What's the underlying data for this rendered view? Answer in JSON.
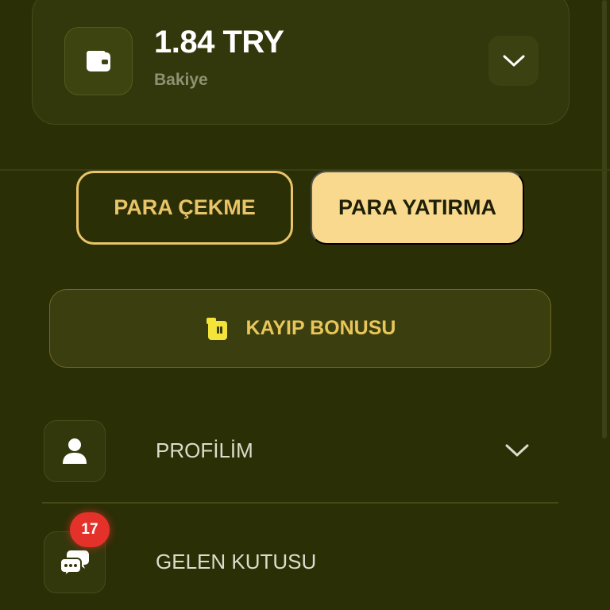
{
  "balance": {
    "amount": "1.84 TRY",
    "label": "Bakiye"
  },
  "actions": {
    "withdraw_label": "PARA ÇEKME",
    "deposit_label": "PARA YATIRMA"
  },
  "bonus": {
    "label": "KAYIP BONUSU"
  },
  "menu": {
    "items": [
      {
        "label": "PROFİLİM",
        "icon": "user-icon",
        "expandable": true
      },
      {
        "label": "GELEN KUTUSU",
        "icon": "chat-icon",
        "badge": "17"
      }
    ]
  },
  "colors": {
    "background": "#2b2f06",
    "accent": "#e9c468",
    "deposit_button": "#f8d98e",
    "badge": "#e4322b"
  }
}
